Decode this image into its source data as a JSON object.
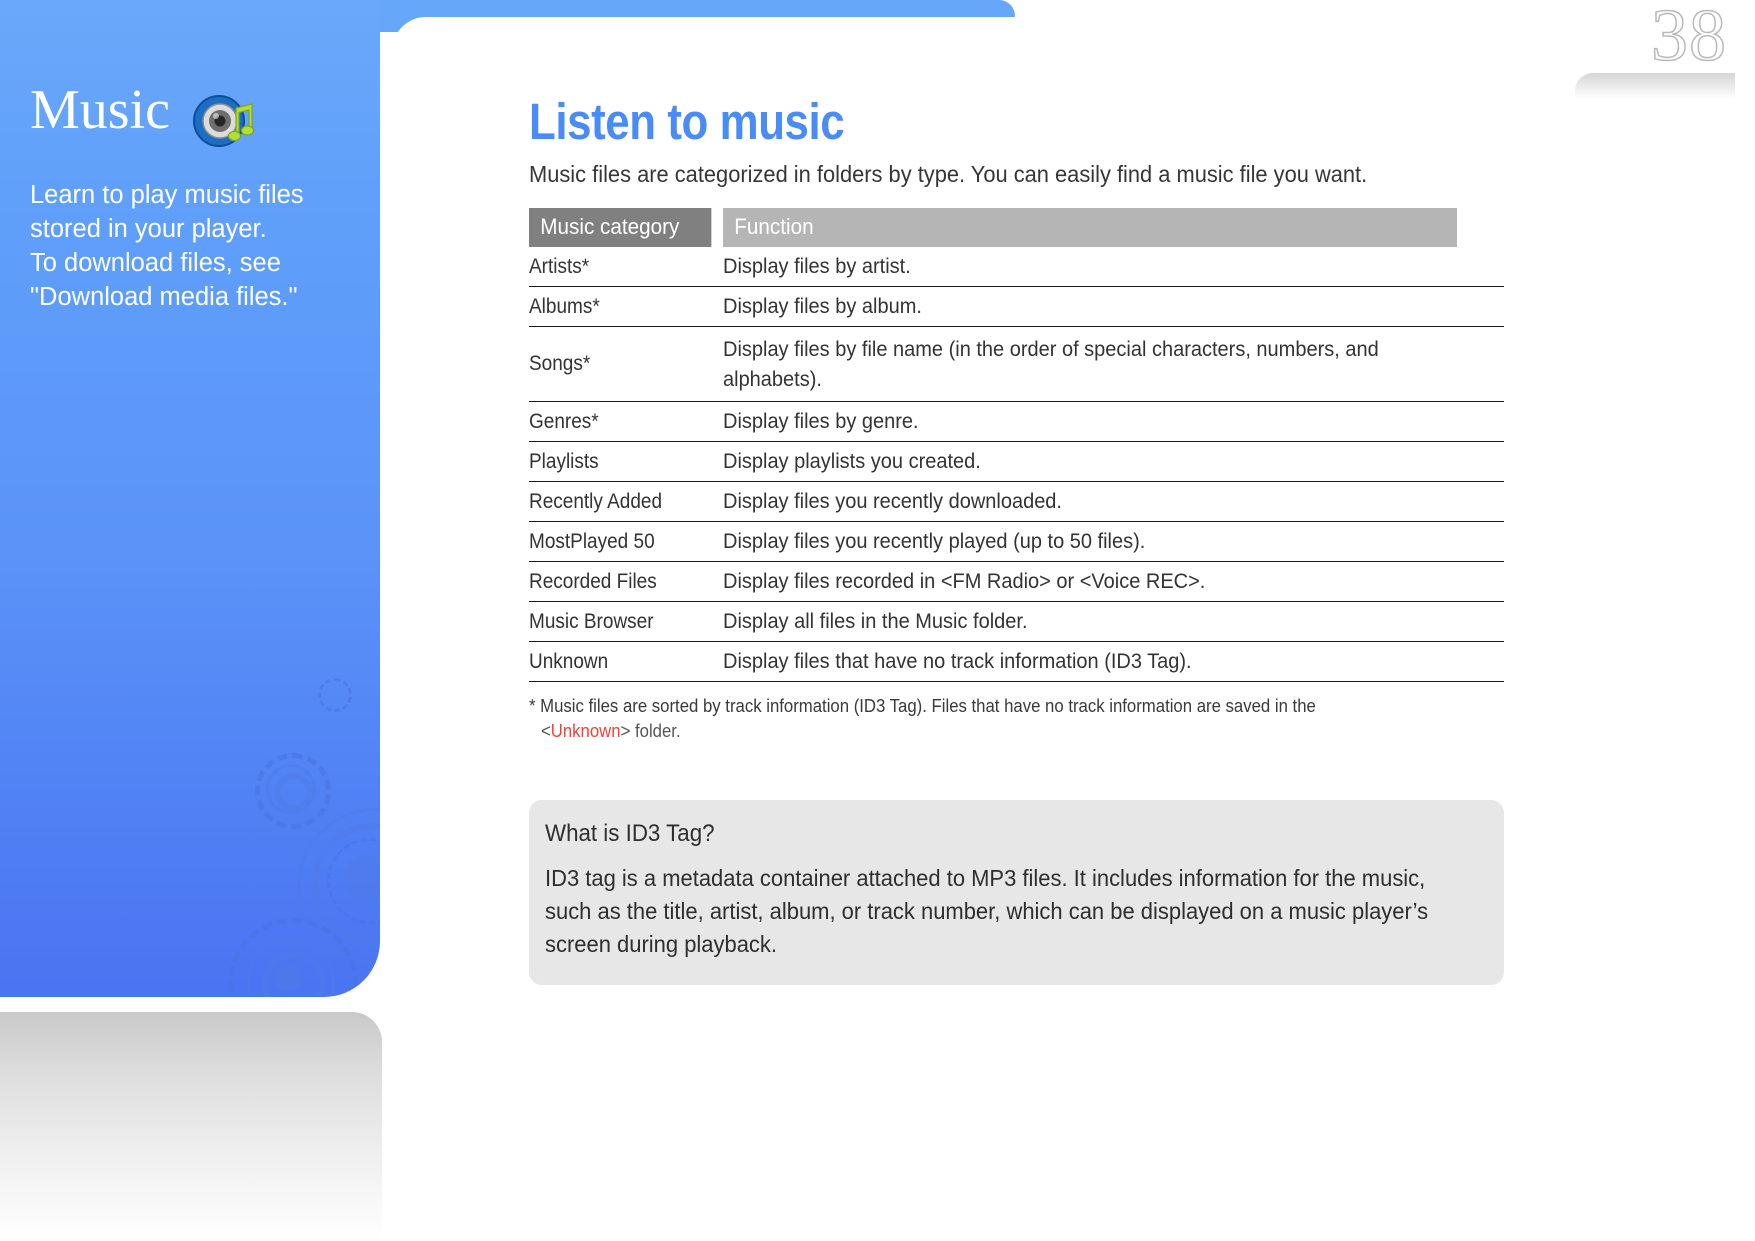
{
  "page": {
    "number": "38"
  },
  "sidebar": {
    "title": "Music",
    "icon": "music-speaker-icon",
    "description": "Learn to play music files stored in your player.\nTo download files, see \"Download media files.\"",
    "accent_color": "#5b93f8"
  },
  "main": {
    "heading": "Listen to music",
    "heading_color": "#4a8cf7",
    "intro": "Music files are categorized in folders by type. You can easily find a music file you want."
  },
  "table": {
    "headers": [
      "Music category",
      "Function"
    ],
    "header_colors": {
      "category": "#808080",
      "function": "#b5b5b5"
    },
    "link_color": "#4a8cf7",
    "rows": [
      {
        "category": "Artists*",
        "function": "Display files  by artist."
      },
      {
        "category": "Albums*",
        "function": "Display files by album."
      },
      {
        "category": "Songs*",
        "function": "Display files by file name (in the order of special characters, numbers, and alphabets)."
      },
      {
        "category": "Genres*",
        "function": "Display files by genre."
      },
      {
        "category": "Playlists",
        "function": "Display playlists you created."
      },
      {
        "category": "Recently Added",
        "function": "Display files you recently downloaded."
      },
      {
        "category": "MostPlayed 50",
        "function": "Display files you recently played (up to 50 files)."
      },
      {
        "category": "Recorded Files",
        "function": "Display files recorded in <FM Radio> or <Voice REC>."
      },
      {
        "category": "Music Browser",
        "function": "Display all files in the Music folder."
      },
      {
        "category": "Unknown",
        "function": "Display files that have no track information (ID3 Tag)."
      }
    ]
  },
  "footnote": {
    "line1": "* Music files are sorted by track information (ID3 Tag). Files that have no track information are saved in the",
    "line2_prefix": "<",
    "line2_highlight": "Unknown",
    "line2_suffix": "> folder.",
    "highlight_color": "#f0413c"
  },
  "info_box": {
    "title": "What is ID3 Tag?",
    "body": "ID3 tag is a metadata container attached to MP3 files. It includes information for the music, such as the title, artist, album, or track number, which can be displayed on a music player’s screen during playback.",
    "background": "#e7e7e7"
  }
}
